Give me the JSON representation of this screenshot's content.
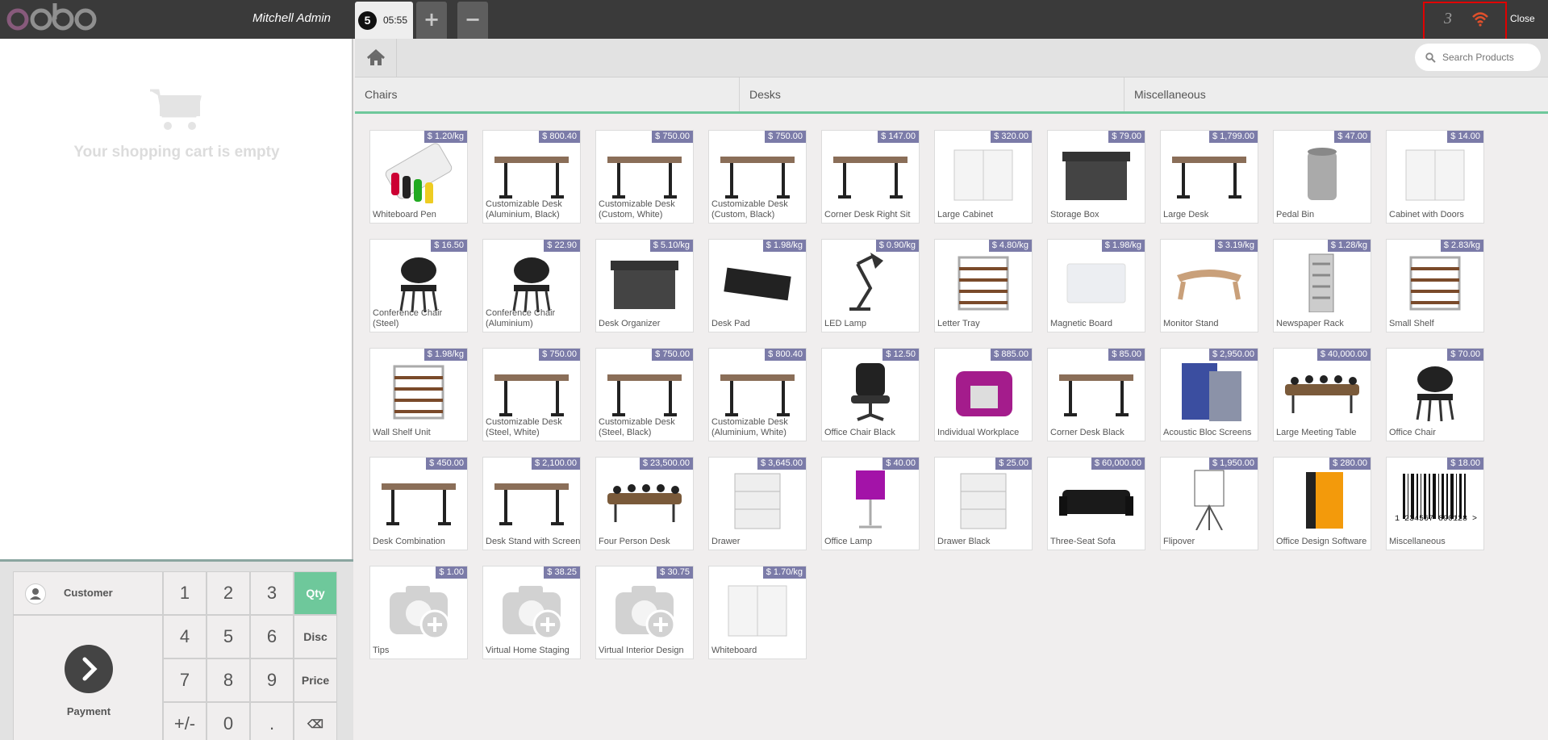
{
  "header": {
    "user": "Mitchell Admin",
    "order_number": "5",
    "order_time": "05:55",
    "add_label": "+",
    "remove_label": "−",
    "status_count": "3",
    "close_label": "Close"
  },
  "cart": {
    "empty_text": "Your shopping cart is empty"
  },
  "pad": {
    "customer_label": "Customer",
    "payment_label": "Payment",
    "keys": [
      "1",
      "2",
      "3",
      "Qty",
      "4",
      "5",
      "6",
      "Disc",
      "7",
      "8",
      "9",
      "Price",
      "+/-",
      "0",
      ".",
      "⌫"
    ]
  },
  "search": {
    "placeholder": "Search Products"
  },
  "categories": [
    "Chairs",
    "Desks",
    "Miscellaneous"
  ],
  "products": [
    {
      "name": "Whiteboard Pen",
      "price": "$ 1.20/kg",
      "icon": "pen"
    },
    {
      "name": "Customizable Desk (Aluminium, Black)",
      "price": "$ 800.40",
      "icon": "desk"
    },
    {
      "name": "Customizable Desk (Custom, White)",
      "price": "$ 750.00",
      "icon": "desk"
    },
    {
      "name": "Customizable Desk (Custom, Black)",
      "price": "$ 750.00",
      "icon": "desk"
    },
    {
      "name": "Corner Desk Right Sit",
      "price": "$ 147.00",
      "icon": "desk"
    },
    {
      "name": "Large Cabinet",
      "price": "$ 320.00",
      "icon": "cabinet"
    },
    {
      "name": "Storage Box",
      "price": "$ 79.00",
      "icon": "box"
    },
    {
      "name": "Large Desk",
      "price": "$ 1,799.00",
      "icon": "desk"
    },
    {
      "name": "Pedal Bin",
      "price": "$ 47.00",
      "icon": "bin"
    },
    {
      "name": "Cabinet with Doors",
      "price": "$ 14.00",
      "icon": "cabinet"
    },
    {
      "name": "Conference Chair (Steel)",
      "price": "$ 16.50",
      "icon": "chair"
    },
    {
      "name": "Conference Chair (Aluminium)",
      "price": "$ 22.90",
      "icon": "chair"
    },
    {
      "name": "Desk Organizer",
      "price": "$ 5.10/kg",
      "icon": "box"
    },
    {
      "name": "Desk Pad",
      "price": "$ 1.98/kg",
      "icon": "pad"
    },
    {
      "name": "LED Lamp",
      "price": "$ 0.90/kg",
      "icon": "lamp"
    },
    {
      "name": "Letter Tray",
      "price": "$ 4.80/kg",
      "icon": "shelf"
    },
    {
      "name": "Magnetic Board",
      "price": "$ 1.98/kg",
      "icon": "board"
    },
    {
      "name": "Monitor Stand",
      "price": "$ 3.19/kg",
      "icon": "stand"
    },
    {
      "name": "Newspaper Rack",
      "price": "$ 1.28/kg",
      "icon": "rack"
    },
    {
      "name": "Small Shelf",
      "price": "$ 2.83/kg",
      "icon": "shelf"
    },
    {
      "name": "Wall Shelf Unit",
      "price": "$ 1.98/kg",
      "icon": "shelf"
    },
    {
      "name": "Customizable Desk (Steel, White)",
      "price": "$ 750.00",
      "icon": "desk"
    },
    {
      "name": "Customizable Desk (Steel, Black)",
      "price": "$ 750.00",
      "icon": "desk"
    },
    {
      "name": "Customizable Desk (Aluminium, White)",
      "price": "$ 800.40",
      "icon": "desk"
    },
    {
      "name": "Office Chair Black",
      "price": "$ 12.50",
      "icon": "officechair"
    },
    {
      "name": "Individual Workplace",
      "price": "$ 885.00",
      "icon": "workplace"
    },
    {
      "name": "Corner Desk Black",
      "price": "$ 85.00",
      "icon": "desk"
    },
    {
      "name": "Acoustic Bloc Screens",
      "price": "$ 2,950.00",
      "icon": "screens"
    },
    {
      "name": "Large Meeting Table",
      "price": "$ 40,000.00",
      "icon": "table"
    },
    {
      "name": "Office Chair",
      "price": "$ 70.00",
      "icon": "chair"
    },
    {
      "name": "Desk Combination",
      "price": "$ 450.00",
      "icon": "desk"
    },
    {
      "name": "Desk Stand with Screen",
      "price": "$ 2,100.00",
      "icon": "desk"
    },
    {
      "name": "Four Person Desk",
      "price": "$ 23,500.00",
      "icon": "table"
    },
    {
      "name": "Drawer",
      "price": "$ 3,645.00",
      "icon": "drawer"
    },
    {
      "name": "Office Lamp",
      "price": "$ 40.00",
      "icon": "lamp2"
    },
    {
      "name": "Drawer Black",
      "price": "$ 25.00",
      "icon": "drawer"
    },
    {
      "name": "Three-Seat Sofa",
      "price": "$ 60,000.00",
      "icon": "sofa"
    },
    {
      "name": "Flipover",
      "price": "$ 1,950.00",
      "icon": "flipover"
    },
    {
      "name": "Office Design Software",
      "price": "$ 280.00",
      "icon": "software"
    },
    {
      "name": "Miscellaneous",
      "price": "$ 18.00",
      "icon": "barcode"
    },
    {
      "name": "Tips",
      "price": "$ 1.00",
      "icon": "camera"
    },
    {
      "name": "Virtual Home Staging",
      "price": "$ 38.25",
      "icon": "camera"
    },
    {
      "name": "Virtual Interior Design",
      "price": "$ 30.75",
      "icon": "camera"
    },
    {
      "name": "Whiteboard",
      "price": "$ 1.70/kg",
      "icon": "cabinet"
    }
  ],
  "barcode_text": "1 234567 890128 >",
  "colors": {
    "price_badge": "#7b7ba8",
    "accent": "#6ec89b",
    "topbar": "#3a3a3a",
    "logo_o": "#875a7b"
  }
}
